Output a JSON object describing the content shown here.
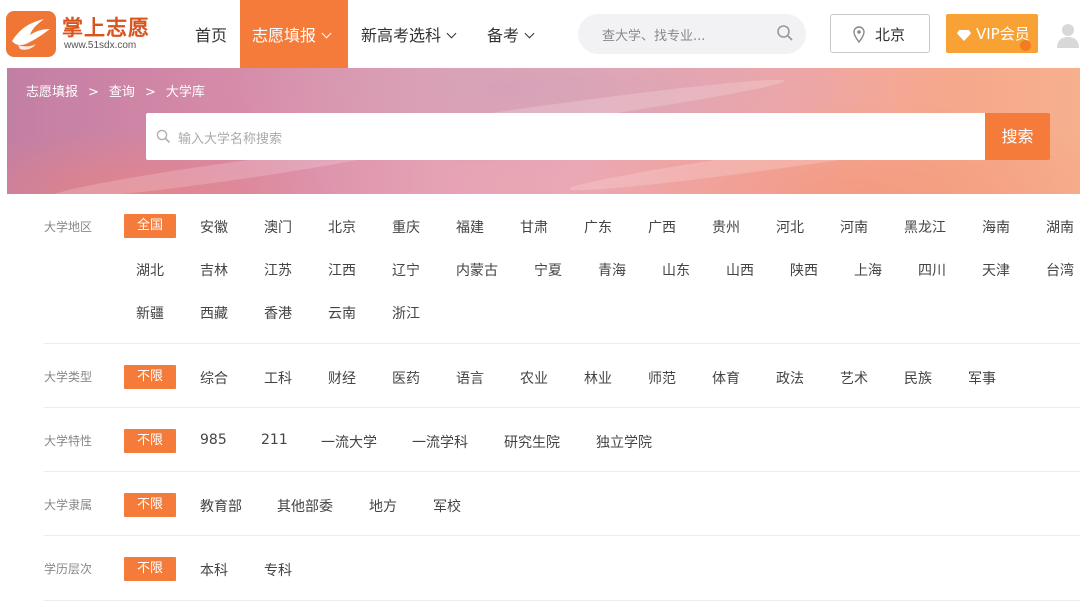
{
  "header": {
    "logo": {
      "name": "掌上志愿",
      "url": "www.51sdx.com"
    },
    "nav": {
      "home": "首页",
      "fill": "志愿填报",
      "subject": "新高考选科",
      "exam": "备考"
    },
    "search_placeholder": "查大学、找专业...",
    "location": "北京",
    "vip": "VIP会员"
  },
  "banner": {
    "breadcrumb": [
      "志愿填报",
      "查询",
      "大学库"
    ],
    "breadcrumb_sep": ">",
    "search_placeholder": "输入大学名称搜索",
    "search_button": "搜索"
  },
  "filters": {
    "region": {
      "label": "大学地区",
      "selected": "全国",
      "row1": [
        "安徽",
        "澳门",
        "北京",
        "重庆",
        "福建",
        "甘肃",
        "广东",
        "广西",
        "贵州",
        "河北",
        "河南",
        "黑龙江",
        "海南",
        "湖南"
      ],
      "row2": [
        "湖北",
        "吉林",
        "江苏",
        "江西",
        "辽宁",
        "内蒙古",
        "宁夏",
        "青海",
        "山东",
        "山西",
        "陕西",
        "上海",
        "四川",
        "天津",
        "台湾"
      ],
      "row3": [
        "新疆",
        "西藏",
        "香港",
        "云南",
        "浙江"
      ]
    },
    "type": {
      "label": "大学类型",
      "selected": "不限",
      "options": [
        "综合",
        "工科",
        "财经",
        "医药",
        "语言",
        "农业",
        "林业",
        "师范",
        "体育",
        "政法",
        "艺术",
        "民族",
        "军事"
      ]
    },
    "feature": {
      "label": "大学特性",
      "selected": "不限",
      "options": [
        "985",
        "211",
        "一流大学",
        "一流学科",
        "研究生院",
        "独立学院"
      ]
    },
    "affiliation": {
      "label": "大学隶属",
      "selected": "不限",
      "options": [
        "教育部",
        "其他部委",
        "地方",
        "军校"
      ]
    },
    "level": {
      "label": "学历层次",
      "selected": "不限",
      "options": [
        "本科",
        "专科"
      ]
    }
  },
  "colors": {
    "accent": "#f47b3a",
    "vip": "#f8a236",
    "brand_text": "#d9541d"
  },
  "icons": {
    "logo": "phoenix-logo-icon",
    "search": "search-icon",
    "location": "map-pin-icon",
    "vip": "diamond-icon",
    "avatar": "user-avatar-icon",
    "dropdown": "chevron-down-icon"
  }
}
